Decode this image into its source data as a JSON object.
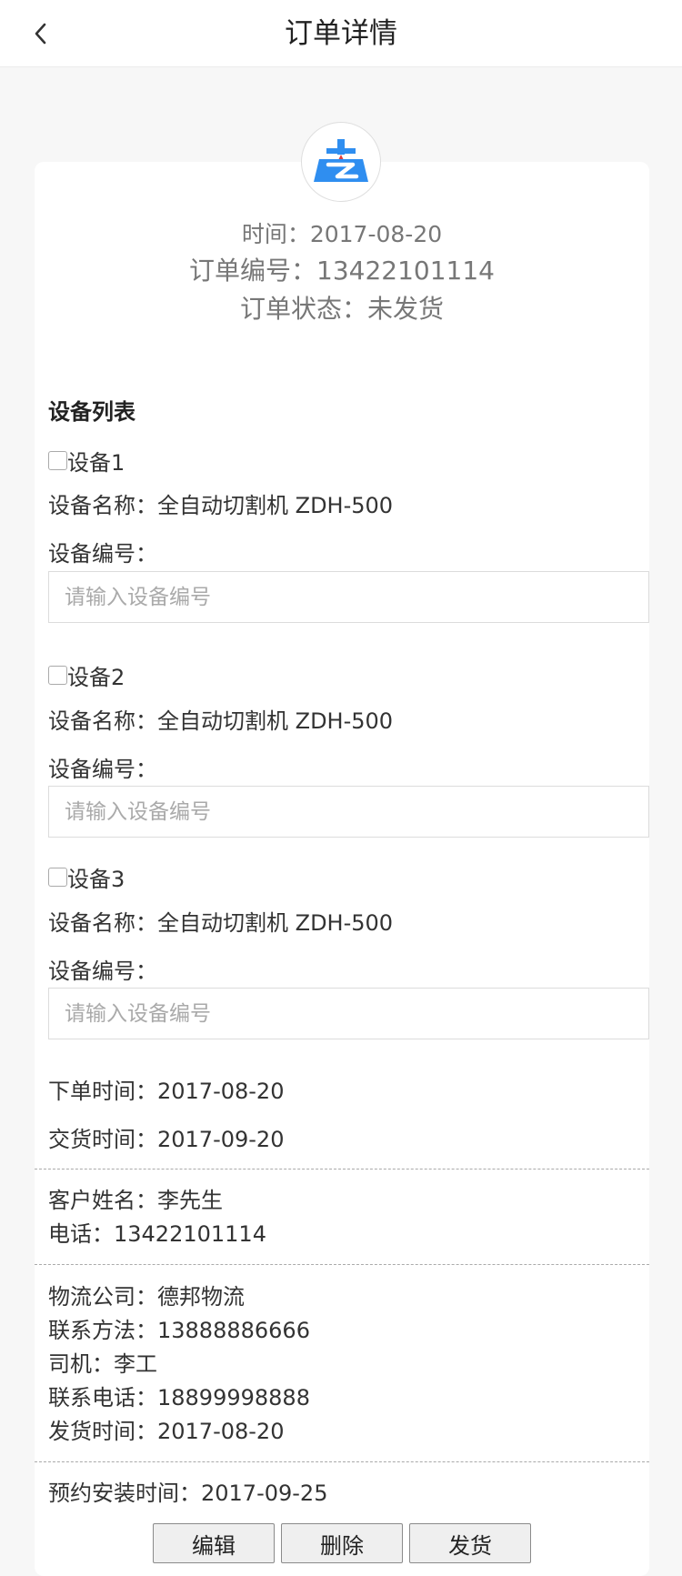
{
  "header": {
    "title": "订单详情"
  },
  "summary": {
    "time": "时间：2017-08-20",
    "order_no": "订单编号：13422101114",
    "status": "订单状态：未发货"
  },
  "devices": {
    "title": "设备列表",
    "items": [
      {
        "label": "设备1",
        "name": "设备名称：全自动切割机 ZDH-500",
        "no_label": "设备编号：",
        "placeholder": "请输入设备编号"
      },
      {
        "label": "设备2",
        "name": "设备名称：全自动切割机 ZDH-500",
        "no_label": "设备编号：",
        "placeholder": "请输入设备编号"
      },
      {
        "label": "设备3",
        "name": "设备名称：全自动切割机 ZDH-500",
        "no_label": "设备编号：",
        "placeholder": "请输入设备编号"
      }
    ]
  },
  "dates": {
    "order_time": "下单时间：2017-08-20",
    "delivery_time": "交货时间：2017-09-20"
  },
  "customer": {
    "name": "客户姓名：李先生",
    "phone": "电话：13422101114"
  },
  "logistics": {
    "company": "物流公司：德邦物流",
    "contact": "联系方法：13888886666",
    "driver": "司机：李工",
    "driver_phone": "联系电话：18899998888",
    "ship_time": "发货时间：2017-08-20"
  },
  "install": {
    "time": "预约安装时间：2017-09-25"
  },
  "actions": {
    "edit": "编辑",
    "delete": "删除",
    "ship": "发货"
  },
  "colors": {
    "logo_blue": "#2f8ef0",
    "logo_red": "#e23b3b"
  }
}
